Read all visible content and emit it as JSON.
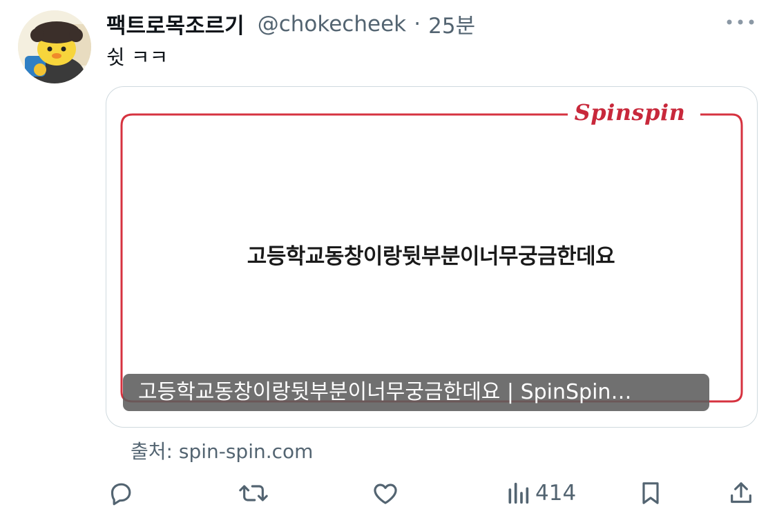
{
  "tweet": {
    "display_name": "팩트로목조르기",
    "handle": "@chokecheek",
    "separator": "·",
    "time": "25분",
    "text": "쉿 ㅋㅋ"
  },
  "card": {
    "brand": "Spinspin",
    "headline": "고등학교동창이랑뒷부분이너무궁금한데요",
    "caption": "고등학교동창이랑뒷부분이너무궁금한데요 | SpinSpin…",
    "frame_color": "#d6323f"
  },
  "source": {
    "label": "출처: spin-spin.com"
  },
  "actions": {
    "views_count": "414"
  },
  "icons": [
    "more-icon",
    "reply-icon",
    "retweet-icon",
    "like-icon",
    "views-icon",
    "bookmark-icon",
    "share-icon"
  ],
  "colors": {
    "text_primary": "#0f1419",
    "text_secondary": "#536471",
    "card_border": "#cfd9de",
    "brand_red": "#c8283b"
  }
}
